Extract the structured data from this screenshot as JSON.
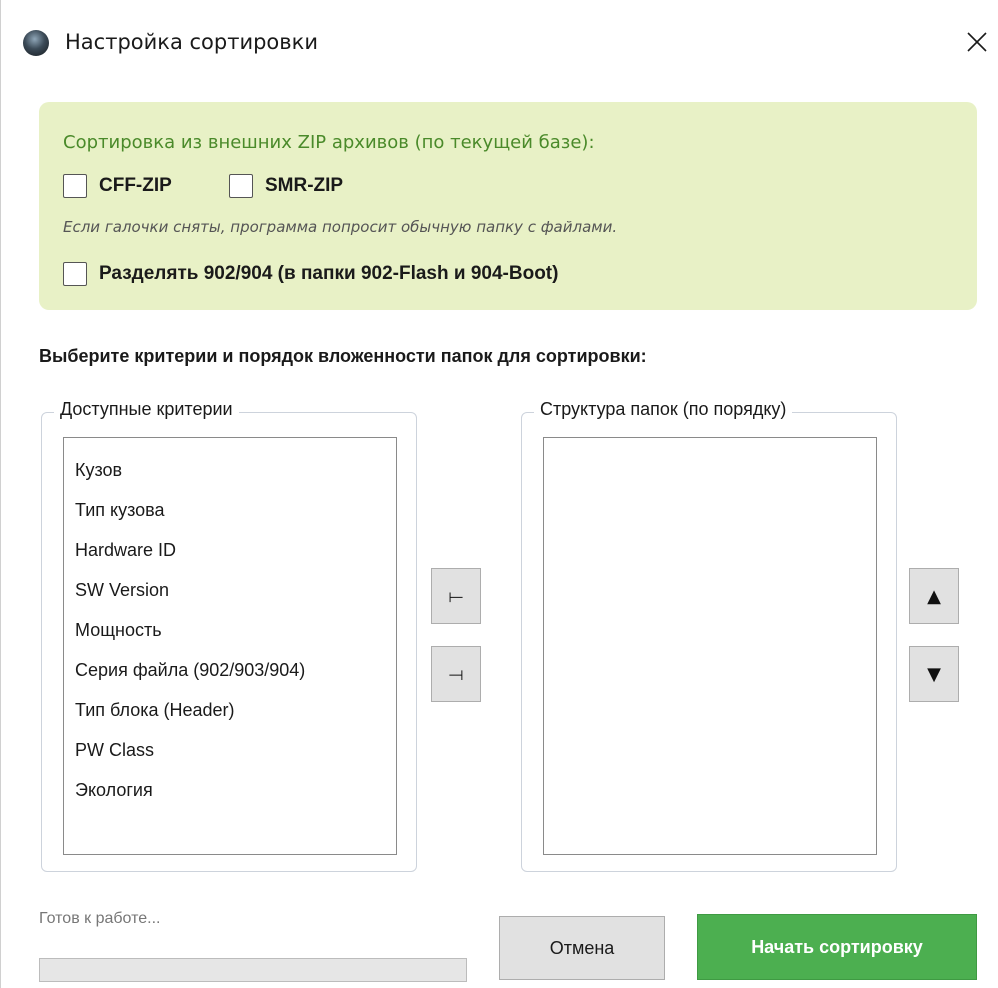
{
  "window": {
    "title": "Настройка сортировки",
    "icons": {
      "app": "app-logo-icon",
      "close": "close-icon"
    }
  },
  "zip_panel": {
    "title": "Сортировка из внешних ZIP архивов (по текущей базе):",
    "cff_label": "CFF-ZIP",
    "cff_checked": false,
    "smr_label": "SMR-ZIP",
    "smr_checked": false,
    "note": "Если галочки сняты, программа попросит обычную папку с файлами.",
    "split_label": "Разделять 902/904 (в папки 902-Flash и 904-Boot)",
    "split_checked": false,
    "bg_color": "#e8f1c6",
    "title_color": "#4a8a2a"
  },
  "criteria": {
    "section_title": "Выберите критерии и порядок вложенности папок для сортировки:",
    "available_label": "Доступные критерии",
    "available_items": [
      "Кузов",
      "Тип кузова",
      "Hardware ID",
      "SW Version",
      "Мощность",
      "Серия файла (902/903/904)",
      "Тип блока (Header)",
      "PW Class",
      "Экология"
    ],
    "structure_label": "Структура папок (по порядку)",
    "structure_items": []
  },
  "transfer_buttons": {
    "add_glyph": "⟝",
    "remove_glyph": "⟞",
    "up_glyph": "▲",
    "down_glyph": "▼"
  },
  "footer": {
    "status": "Готов к работе...",
    "progress_percent": 0,
    "cancel_label": "Отмена",
    "start_label": "Начать сортировку",
    "start_color": "#4caf50"
  }
}
